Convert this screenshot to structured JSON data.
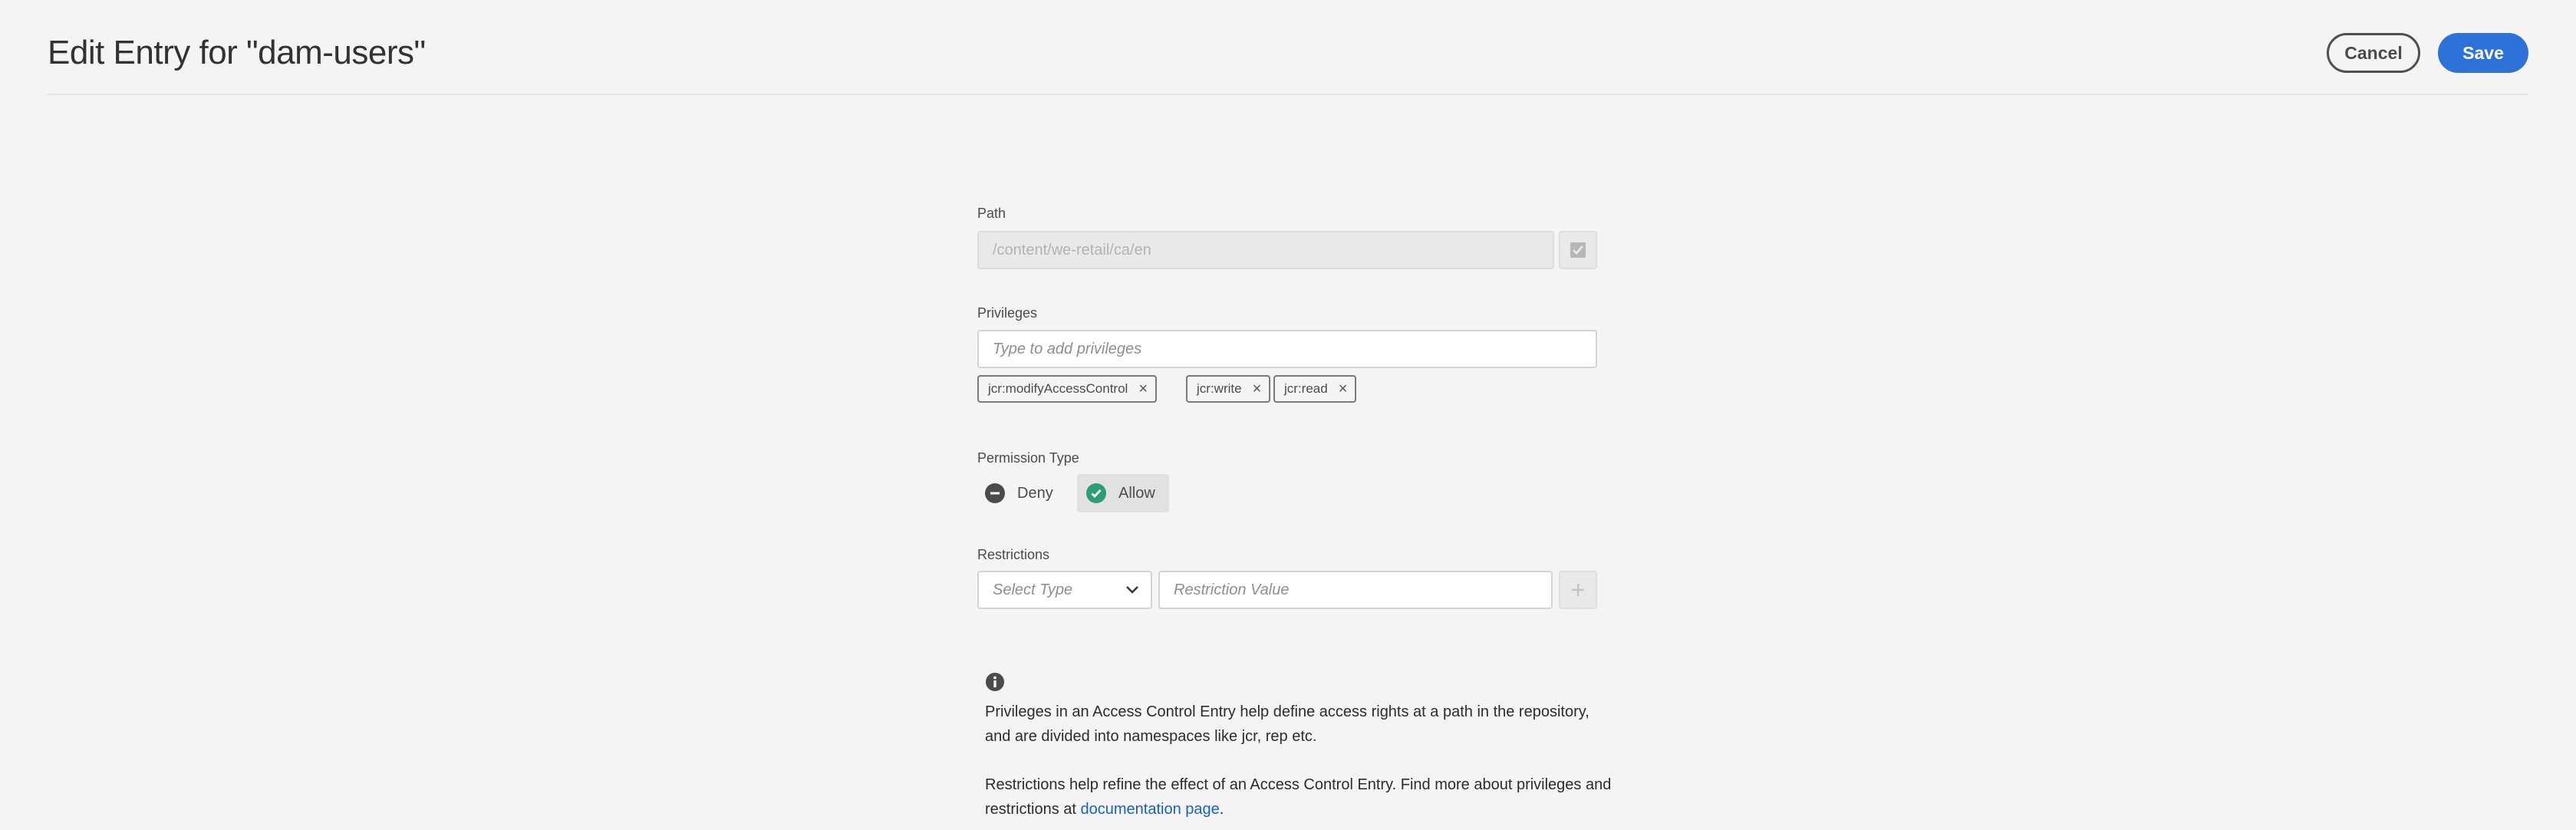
{
  "header": {
    "title": "Edit Entry for \"dam-users\"",
    "cancel_label": "Cancel",
    "save_label": "Save"
  },
  "path": {
    "label": "Path",
    "value": "/content/we-retail/ca/en"
  },
  "privileges": {
    "label": "Privileges",
    "placeholder": "Type to add privileges",
    "tags": [
      "jcr:modifyAccessControl",
      "jcr:write",
      "jcr:read"
    ]
  },
  "permission_type": {
    "label": "Permission Type",
    "deny_label": "Deny",
    "allow_label": "Allow",
    "selected": "Allow"
  },
  "restrictions": {
    "label": "Restrictions",
    "select_placeholder": "Select Type",
    "value_placeholder": "Restriction Value"
  },
  "help": {
    "paragraph1": "Privileges in an Access Control Entry help define access rights at a path in the repository, and are divided into namespaces like jcr, rep etc.",
    "paragraph2_prefix": "Restrictions help refine the effect of an Access Control Entry. Find more about privileges and restrictions at ",
    "link_text": "documentation page",
    "paragraph2_suffix": "."
  },
  "colors": {
    "accent": "#2c72d9",
    "allow_green": "#2d9d78",
    "link": "#1a5fc6"
  }
}
